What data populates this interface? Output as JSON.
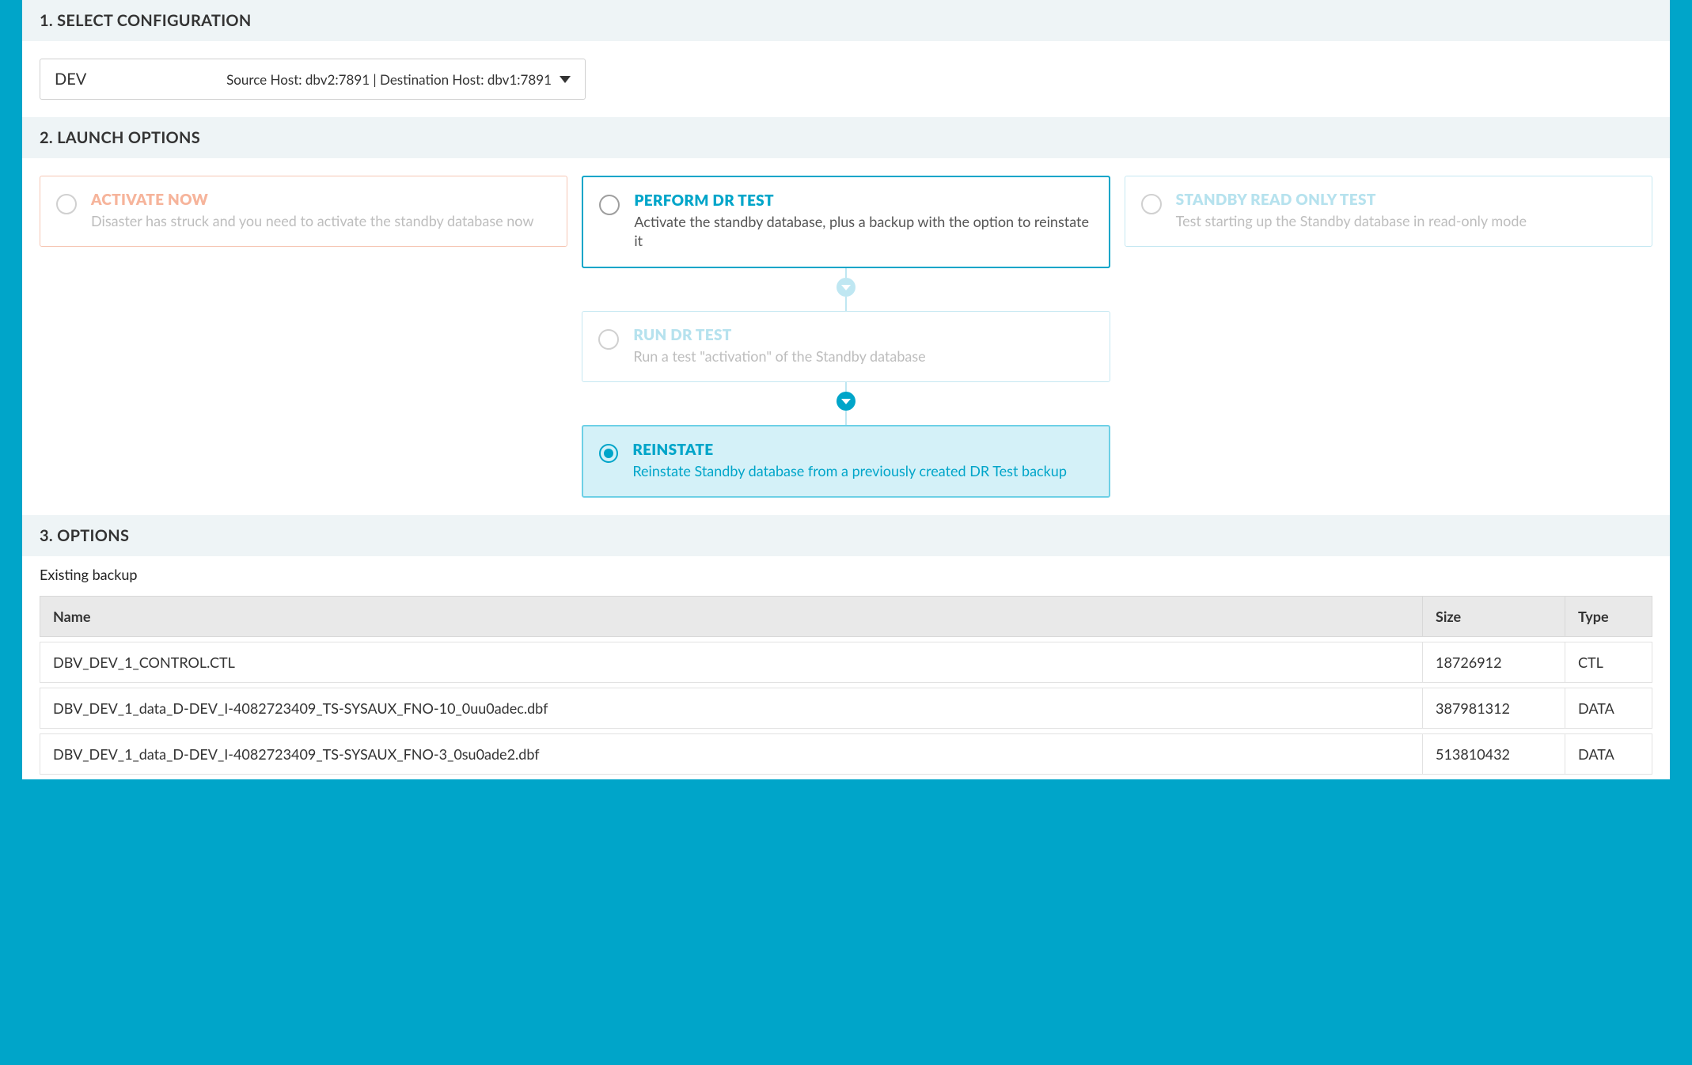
{
  "colors": {
    "accent": "#00a5c9",
    "orange": "#f29b76",
    "faded_cyan": "#bfe7f2"
  },
  "section1": {
    "title": "1. SELECT CONFIGURATION",
    "env": "DEV",
    "hosts": "Source Host: dbv2:7891 | Destination Host: dbv1:7891"
  },
  "section2": {
    "title": "2. LAUNCH OPTIONS",
    "activate": {
      "title": "ACTIVATE NOW",
      "desc": "Disaster has struck and you need to activate the standby database now"
    },
    "perform": {
      "title": "PERFORM DR TEST",
      "desc": "Activate the standby database, plus a backup with the option to reinstate it"
    },
    "standby": {
      "title": "STANDBY READ ONLY TEST",
      "desc": "Test starting up the Standby database in read-only mode"
    },
    "run": {
      "title": "RUN DR TEST",
      "desc": "Run a test \"activation\" of the Standby database"
    },
    "reinstate": {
      "title": "REINSTATE",
      "desc": "Reinstate Standby database from a previously created DR Test backup"
    }
  },
  "section3": {
    "title": "3. OPTIONS",
    "subhead": "Existing backup",
    "columns": {
      "name": "Name",
      "size": "Size",
      "type": "Type"
    },
    "rows": [
      {
        "name": "DBV_DEV_1_CONTROL.CTL",
        "size": "18726912",
        "type": "CTL"
      },
      {
        "name": "DBV_DEV_1_data_D-DEV_I-4082723409_TS-SYSAUX_FNO-10_0uu0adec.dbf",
        "size": "387981312",
        "type": "DATA"
      },
      {
        "name": "DBV_DEV_1_data_D-DEV_I-4082723409_TS-SYSAUX_FNO-3_0su0ade2.dbf",
        "size": "513810432",
        "type": "DATA"
      }
    ]
  }
}
